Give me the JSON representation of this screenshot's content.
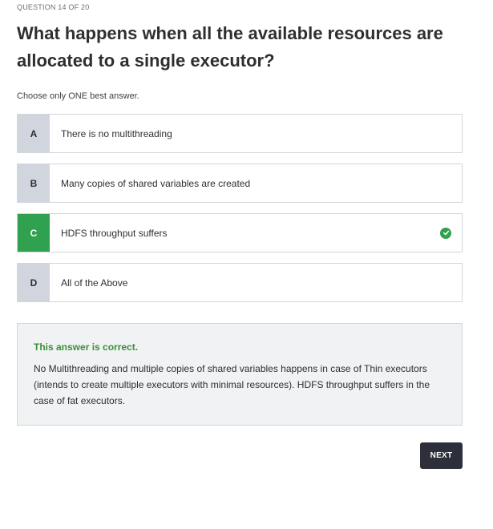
{
  "quiz": {
    "counter": "QUESTION 14 OF 20",
    "question": "What happens when all the available resources are allocated to a single executor?",
    "instruction": "Choose only ONE best answer.",
    "options": [
      {
        "letter": "A",
        "text": "There is no multithreading",
        "correct": false
      },
      {
        "letter": "B",
        "text": "Many copies of shared variables are created",
        "correct": false
      },
      {
        "letter": "C",
        "text": "HDFS throughput suffers",
        "correct": true
      },
      {
        "letter": "D",
        "text": "All of the Above",
        "correct": false
      }
    ]
  },
  "feedback": {
    "status": "This answer is correct.",
    "explanation": "No Multithreading and multiple copies of shared variables happens in case of Thin executors (intends to create multiple executors with minimal resources). HDFS throughput suffers in the case of fat executors."
  },
  "actions": {
    "next_label": "NEXT"
  },
  "colors": {
    "correct": "#30a14e",
    "letter_bg": "#d1d5de",
    "next_bg": "#2d2f3a"
  },
  "icons": {
    "correct_mark": "check-circle-icon"
  }
}
